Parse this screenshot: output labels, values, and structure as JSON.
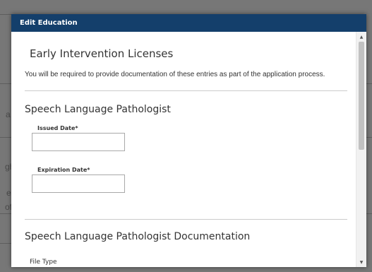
{
  "modal": {
    "title": "Edit Education",
    "section_title": "Early Intervention Licenses",
    "intro_text": "You will be required to provide documentation of these entries as part of the application process.",
    "license_section_title": "Speech Language Pathologist",
    "issued_date": {
      "label": "Issued Date*",
      "value": ""
    },
    "expiration_date": {
      "label": "Expiration Date*",
      "value": ""
    },
    "documentation_section_title": "Speech Language Pathologist Documentation",
    "file_type_label": "File Type"
  },
  "scrollbar": {
    "up_icon": "triangle-up-icon",
    "down_icon": "triangle-down-icon"
  },
  "background_fragments": {
    "frag_1": "a",
    "frag_2": "gh",
    "frag_3": "e",
    "frag_4": "of"
  },
  "colors": {
    "header_bg": "#143f6b",
    "header_text": "#ffffff",
    "overlay": "#6f6f6f"
  }
}
